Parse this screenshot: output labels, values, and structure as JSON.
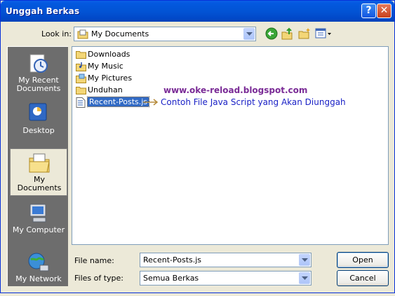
{
  "window": {
    "title": "Unggah Berkas"
  },
  "toolbar": {
    "lookin_label": "Look in:",
    "lookin_value": "My Documents",
    "icons": [
      "back-icon",
      "up-folder-icon",
      "new-folder-icon",
      "views-menu-icon"
    ]
  },
  "places": [
    {
      "label": "My Recent Documents",
      "icon": "recent-documents-icon",
      "selected": false
    },
    {
      "label": "Desktop",
      "icon": "desktop-icon",
      "selected": false
    },
    {
      "label": "My Documents",
      "icon": "my-documents-icon",
      "selected": true
    },
    {
      "label": "My Computer",
      "icon": "my-computer-icon",
      "selected": false
    },
    {
      "label": "My Network",
      "icon": "my-network-icon",
      "selected": false
    }
  ],
  "files": [
    {
      "name": "Downloads",
      "icon": "folder-icon"
    },
    {
      "name": "My Music",
      "icon": "music-folder-icon"
    },
    {
      "name": "My Pictures",
      "icon": "pictures-folder-icon"
    },
    {
      "name": "Unduhan",
      "icon": "folder-icon"
    },
    {
      "name": "Recent-Posts.js",
      "icon": "script-file-icon",
      "selected": true
    }
  ],
  "overlay": {
    "watermark": "www.oke-reload.blogspot.com",
    "annotation": "Contoh File Java Script yang Akan Diunggah"
  },
  "form": {
    "filename_label": "File name:",
    "filename_value": "Recent-Posts.js",
    "filetype_label": "Files of type:",
    "filetype_value": "Semua Berkas"
  },
  "buttons": {
    "open": "Open",
    "cancel": "Cancel"
  },
  "colors": {
    "titlebar": "#0254d5",
    "selection": "#316ac5",
    "places_bg": "#6d6d6d",
    "watermark": "#7a2b96",
    "annotation": "#1a21c6"
  }
}
